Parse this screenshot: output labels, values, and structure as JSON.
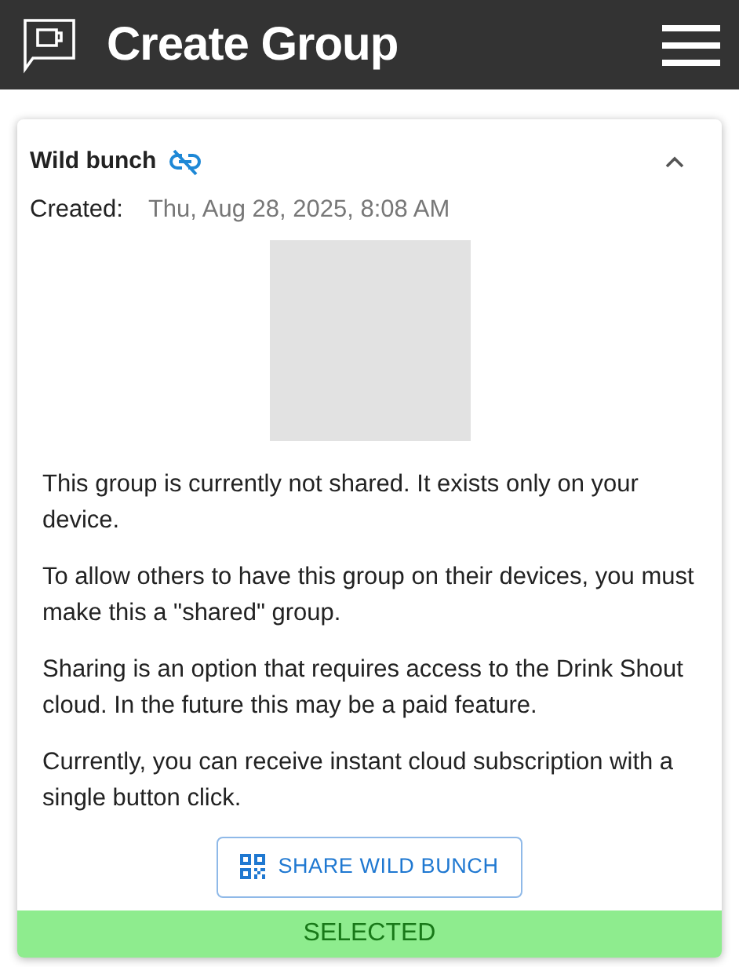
{
  "header": {
    "title": "Create Group"
  },
  "group": {
    "name": "Wild bunch",
    "shared": false,
    "expanded": true,
    "created_label": "Created:",
    "created_value": "Thu, Aug 28, 2025, 8:08 AM",
    "paragraphs": [
      "This group is currently not shared. It exists only on your device.",
      "To allow others to have this group on their devices, you must make this a \"shared\" group.",
      "Sharing is an option that requires access to the Drink Shout cloud. In the future this may be a paid feature.",
      "Currently, you can receive instant cloud subscription with a single button click."
    ],
    "share_button": "SHARE WILD BUNCH",
    "status": "SELECTED"
  }
}
